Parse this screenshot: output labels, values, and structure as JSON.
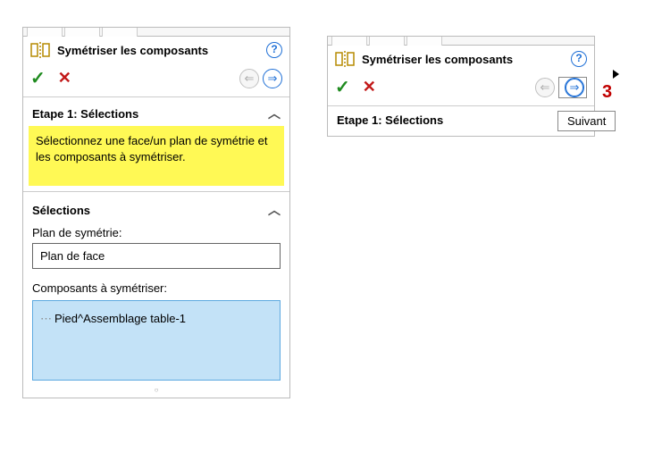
{
  "title": "Symétriser les composants",
  "actions": {
    "help": "?",
    "ok": "✓",
    "cancel": "✕",
    "prev": "⇐",
    "next": "⇒"
  },
  "step_header": "Etape 1: Sélections",
  "hint": "Sélectionnez une face/un plan de symétrie et les composants à symétriser.",
  "selections_header": "Sélections",
  "plane_label": "Plan de symétrie:",
  "plane_value": "Plan de face",
  "components_label": "Composants à symétriser:",
  "components": [
    "Pied^Assemblage table-1"
  ],
  "tooltip": "Suivant",
  "annotation": "3"
}
